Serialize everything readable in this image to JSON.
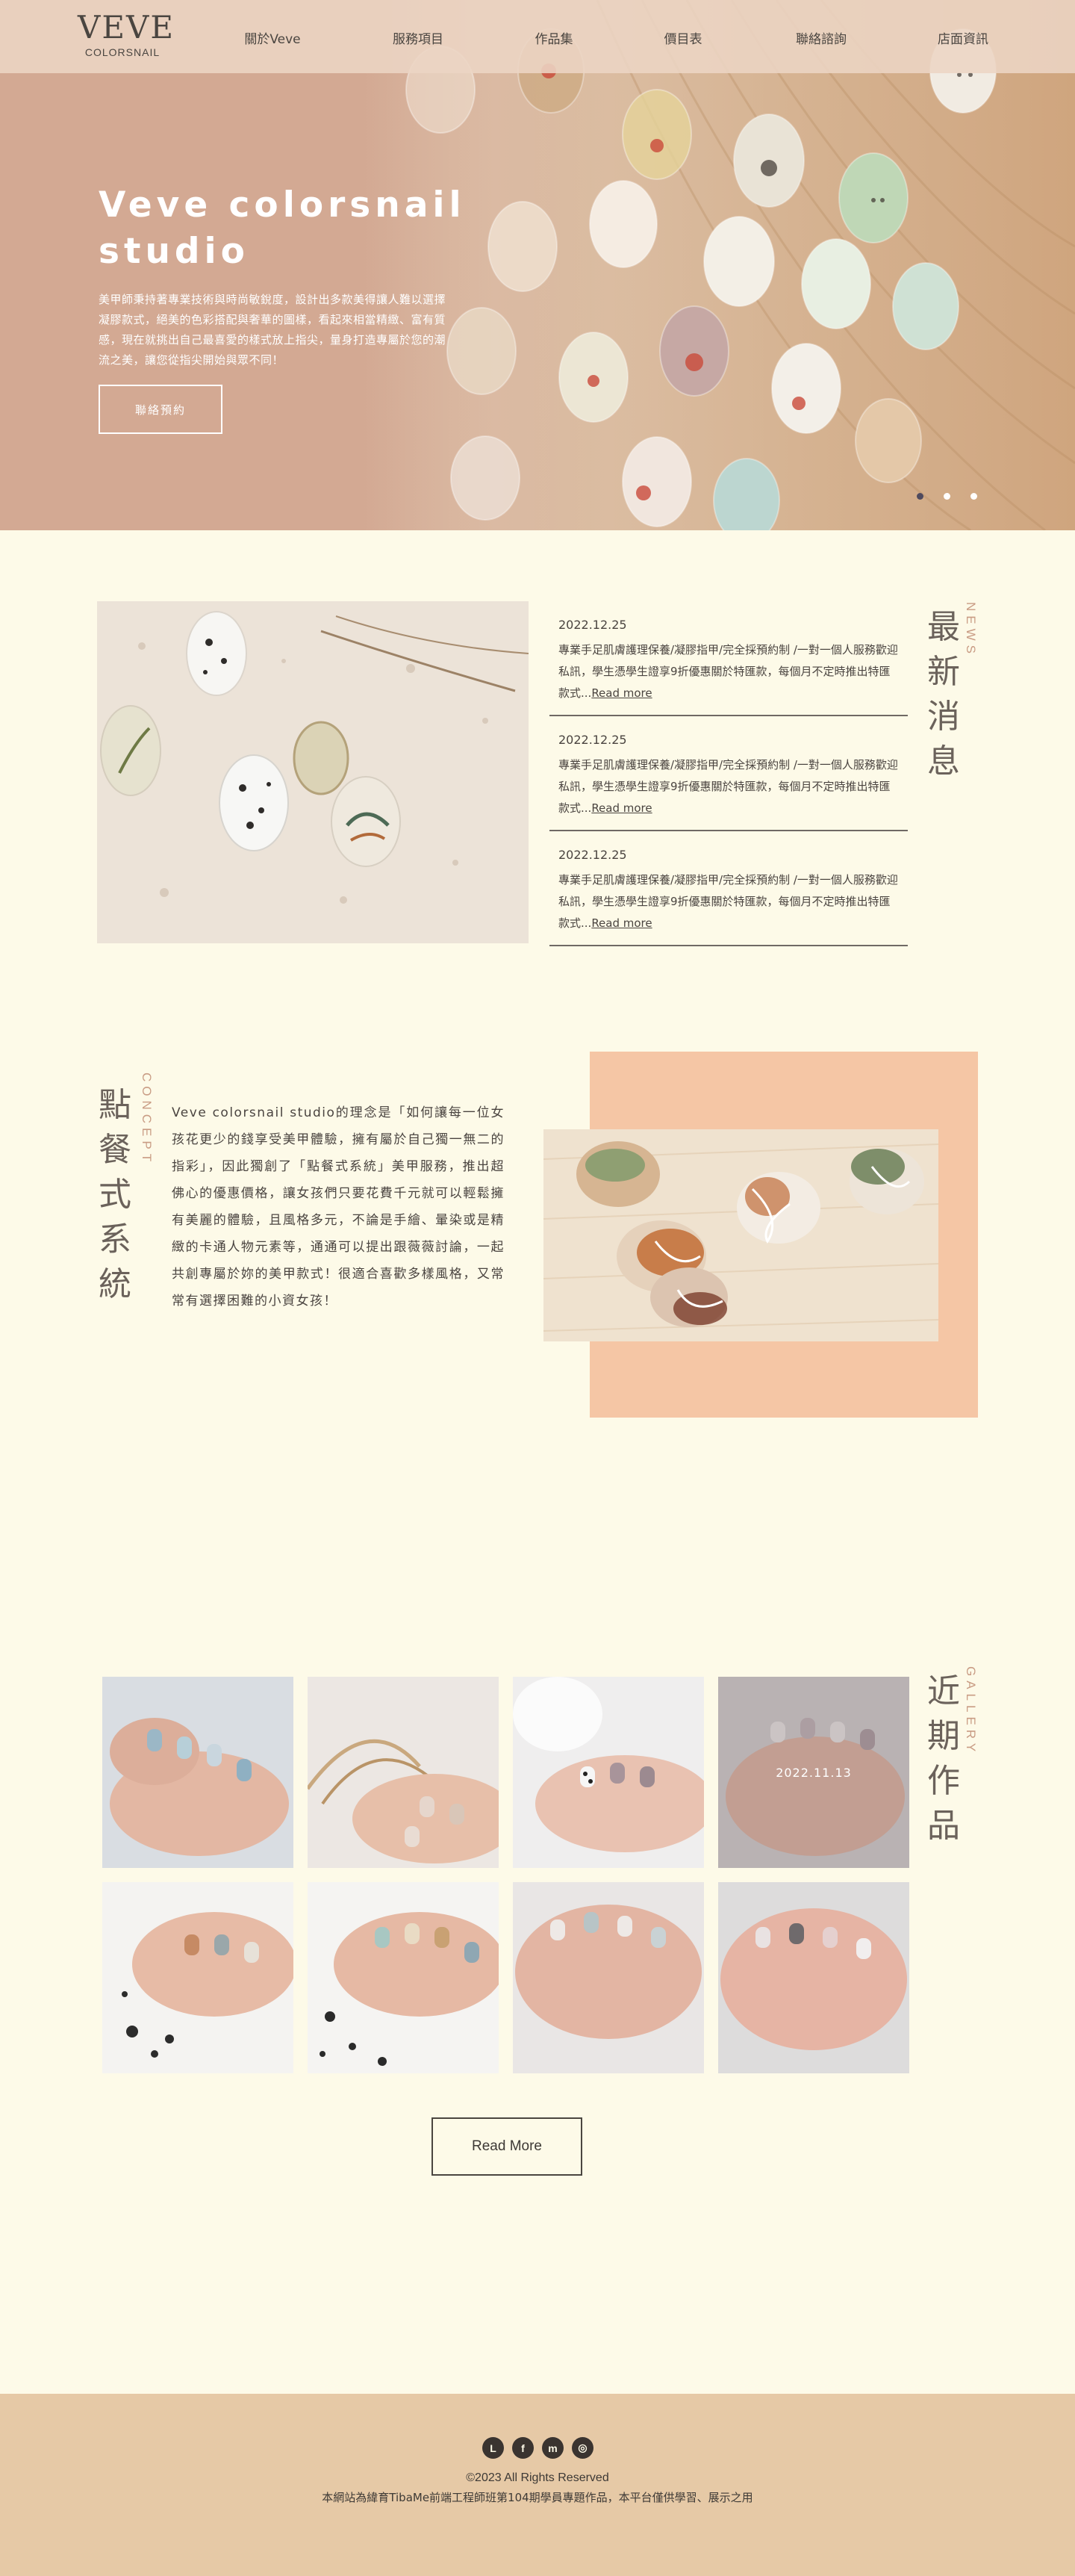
{
  "header": {
    "logo_mark": "VEVE",
    "logo_sub": "COLORSNAIL",
    "nav": [
      "關於Veve",
      "服務項目",
      "作品集",
      "價目表",
      "聯絡諮詢",
      "店面資訊"
    ]
  },
  "hero": {
    "title": "Veve colorsnail studio",
    "description": "美甲師秉持著專業技術與時尚敏銳度，設計出多款美得讓人難以選擇凝膠款式，絕美的色彩搭配與奢華的圖樣，看起來相當精緻、富有質感，現在就挑出自己最喜愛的樣式放上指尖，量身打造專屬於您的潮流之美，讓您從指尖開始與眾不同！",
    "button": "聯絡預約",
    "slide_count": 3,
    "active_slide": 1
  },
  "news": {
    "title": [
      "最",
      "新",
      "消",
      "息"
    ],
    "subtitle": "NEWS",
    "items": [
      {
        "date": "2022.12.25",
        "text": "專業手足肌膚護理保養/凝膠指甲/完全採預約制 /一對一個人服務歡迎私訊，學生憑學生證享9折優惠關於特匯款，每個月不定時推出特匯款式...",
        "link": "Read more"
      },
      {
        "date": "2022.12.25",
        "text": "專業手足肌膚護理保養/凝膠指甲/完全採預約制 /一對一個人服務歡迎私訊，學生憑學生證享9折優惠關於特匯款，每個月不定時推出特匯款式...",
        "link": "Read more"
      },
      {
        "date": "2022.12.25",
        "text": "專業手足肌膚護理保養/凝膠指甲/完全採預約制 /一對一個人服務歡迎私訊，學生憑學生證享9折優惠關於特匯款，每個月不定時推出特匯款式...",
        "link": "Read more"
      }
    ]
  },
  "concept": {
    "title": [
      "點",
      "餐",
      "式",
      "系",
      "統"
    ],
    "subtitle": "CONCEPT",
    "text": "Veve colorsnail studio的理念是「如何讓每一位女孩花更少的錢享受美甲體驗，擁有屬於自己獨一無二的指彩」，因此獨創了「點餐式系統」美甲服務，推出超佛心的優惠價格，讓女孩們只要花費千元就可以輕鬆擁有美麗的體驗，且風格多元，不論是手繪、暈染或是精緻的卡通人物元素等，通通可以提出跟薇薇討論，一起共創專屬於妳的美甲款式！很適合喜歡多樣風格，又常常有選擇困難的小資女孩！"
  },
  "gallery": {
    "title": [
      "近",
      "期",
      "作",
      "品"
    ],
    "subtitle": "GALLERY",
    "hover_date": "2022.11.13",
    "button": "Read More",
    "photos": [
      "gallery-photo-1",
      "gallery-photo-2",
      "gallery-photo-3",
      "gallery-photo-4",
      "gallery-photo-5",
      "gallery-photo-6",
      "gallery-photo-7",
      "gallery-photo-8"
    ]
  },
  "footer": {
    "social": [
      {
        "icon": "line-icon",
        "glyph": "L"
      },
      {
        "icon": "facebook-icon",
        "glyph": "f"
      },
      {
        "icon": "messenger-icon",
        "glyph": "m"
      },
      {
        "icon": "instagram-icon",
        "glyph": "◎"
      }
    ],
    "copyright": "©2023 All Rights Reserved",
    "note": "本網站為緯育TibaMe前端工程師班第104期學員專題作品，本平台僅供學習、展示之用"
  },
  "colors": {
    "page_bg": "#fdfae8",
    "header_bg": "#ecd5c4",
    "accent_peach": "#f5c6a5",
    "accent_sub": "#c99c84",
    "footer_bg": "#e6c9a6",
    "text": "#4a4440"
  }
}
